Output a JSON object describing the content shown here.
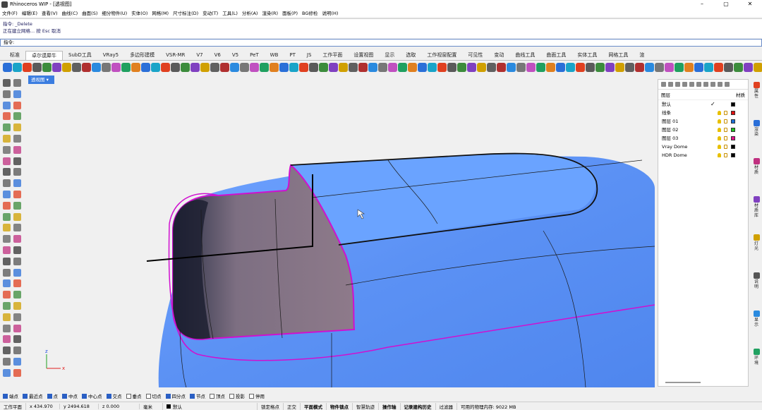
{
  "app": {
    "title": "Rhinoceros WIP - [透视图]",
    "window_buttons": [
      "–",
      "▢",
      "✕"
    ]
  },
  "menu": [
    "文件(F)",
    "编辑(E)",
    "查看(V)",
    "曲线(C)",
    "曲面(S)",
    "细分物件(U)",
    "实体(O)",
    "网格(M)",
    "尺寸标注(D)",
    "变动(T)",
    "工具(L)",
    "分析(A)",
    "渲染(R)",
    "面板(P)",
    "BG修检",
    "说明(H)"
  ],
  "command_history": [
    "指令: _Delete",
    "正在建立网格... 按 Esc 取消"
  ],
  "command_prompt": "指令:",
  "tabs": [
    "标准",
    "卓尔谟犀牛",
    "SubD工具",
    "VRay5",
    "多边形建模",
    "VSR-MR",
    "V7",
    "V6",
    "V5",
    "PeT",
    "WB",
    "PT",
    "JS",
    "工作平面",
    "设置视图",
    "显示",
    "选取",
    "工作视窗配置",
    "可见性",
    "变动",
    "曲线工具",
    "曲面工具",
    "实体工具",
    "网格工具",
    "渲"
  ],
  "active_tab": "卓尔谟犀牛",
  "viewport": {
    "label": "透视图",
    "axis_x": "x",
    "axis_y": "y",
    "axis_z": "z"
  },
  "layers_panel": {
    "header_left": "图层",
    "header_right": "材质",
    "rows": [
      {
        "name": "默认",
        "check": "✓",
        "color": "#000000"
      },
      {
        "name": "线条",
        "check": "",
        "color": "#e01010"
      },
      {
        "name": "图层 01",
        "check": "",
        "color": "#1e6fd8"
      },
      {
        "name": "图层 02",
        "check": "",
        "color": "#20c020"
      },
      {
        "name": "图层 03",
        "check": "",
        "color": "#e0108a"
      },
      {
        "name": "Vray Dome",
        "check": "",
        "color": "#000000"
      },
      {
        "name": "HDR Dome",
        "check": "",
        "color": "#000000"
      }
    ]
  },
  "right_tabs": [
    "属性",
    "渲染",
    "材质",
    "材质库",
    "灯光",
    "说明",
    "显示",
    "环境"
  ],
  "osnaps": [
    {
      "label": "端点",
      "on": true
    },
    {
      "label": "最近点",
      "on": true
    },
    {
      "label": "点",
      "on": true
    },
    {
      "label": "中点",
      "on": true
    },
    {
      "label": "中心点",
      "on": true
    },
    {
      "label": "交点",
      "on": true
    },
    {
      "label": "垂点",
      "on": false
    },
    {
      "label": "切点",
      "on": false
    },
    {
      "label": "四分点",
      "on": true
    },
    {
      "label": "节点",
      "on": true
    },
    {
      "label": "顶点",
      "on": false
    },
    {
      "label": "投影",
      "on": false
    },
    {
      "label": "停用",
      "on": false
    }
  ],
  "status": {
    "cplane": "工作平面",
    "x": "x 434.970",
    "y": "y 2494.618",
    "z": "z 0.000",
    "units": "毫米",
    "layer": "默认",
    "items": [
      "锁定格点",
      "正交",
      "平面模式",
      "物件锁点",
      "智慧轨迹",
      "操作轴",
      "记录建构历史",
      "过滤器"
    ],
    "bold_items": [
      "平面模式",
      "物件锁点",
      "操作轴",
      "记录建构历史"
    ],
    "memory": "可用的物理内存: 9022 MB"
  },
  "colors": {
    "accent": "#3b7de0",
    "surface": "#5f95f5",
    "edge_highlight": "#d010d0"
  }
}
